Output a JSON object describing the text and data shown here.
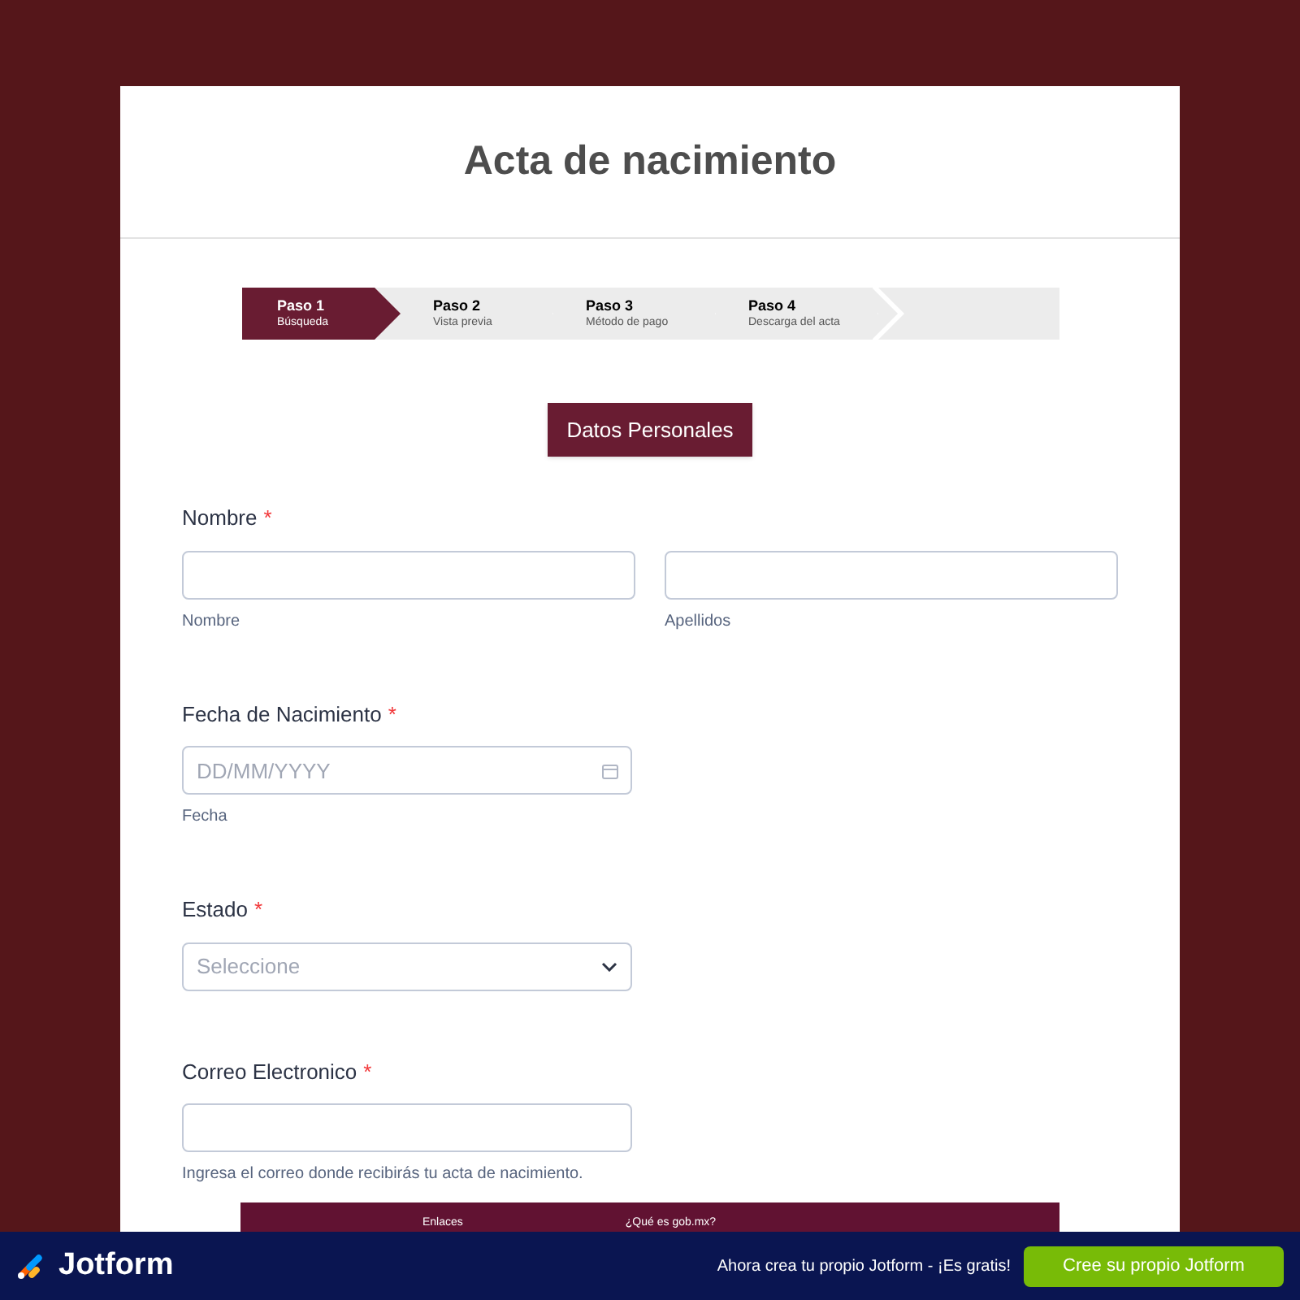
{
  "title": "Acta de nacimiento",
  "steps": [
    {
      "label": "Paso 1",
      "sub": "Búsqueda",
      "selected": true
    },
    {
      "label": "Paso 2",
      "sub": "Vista previa",
      "selected": false
    },
    {
      "label": "Paso 3",
      "sub": "Método de pago",
      "selected": false
    },
    {
      "label": "Paso 4",
      "sub": "Descarga del acta",
      "selected": false
    }
  ],
  "section_button": "Datos Personales",
  "fields": [
    {
      "kind": "name",
      "label": "Nombre",
      "required_mark": "*",
      "sublabels": [
        "Nombre",
        "Apellidos"
      ]
    },
    {
      "kind": "date",
      "label": "Fecha de Nacimiento",
      "required_mark": "*",
      "placeholder": "DD/MM/YYYY",
      "sublabel": "Fecha"
    },
    {
      "kind": "select",
      "label": "Estado",
      "required_mark": "*",
      "placeholder": "Seleccione"
    },
    {
      "kind": "email",
      "label": "Correo Electronico",
      "required_mark": "*",
      "sublabel": "Ingresa el correo donde recibirás tu acta de nacimiento."
    }
  ],
  "footer_links": [
    "Enlaces",
    "¿Qué es gob.mx?"
  ],
  "banner": {
    "brand": "Jotform",
    "text": "Ahora crea tu propio Jotform - ¡Es gratis!",
    "button": "Cree su propio Jotform"
  }
}
